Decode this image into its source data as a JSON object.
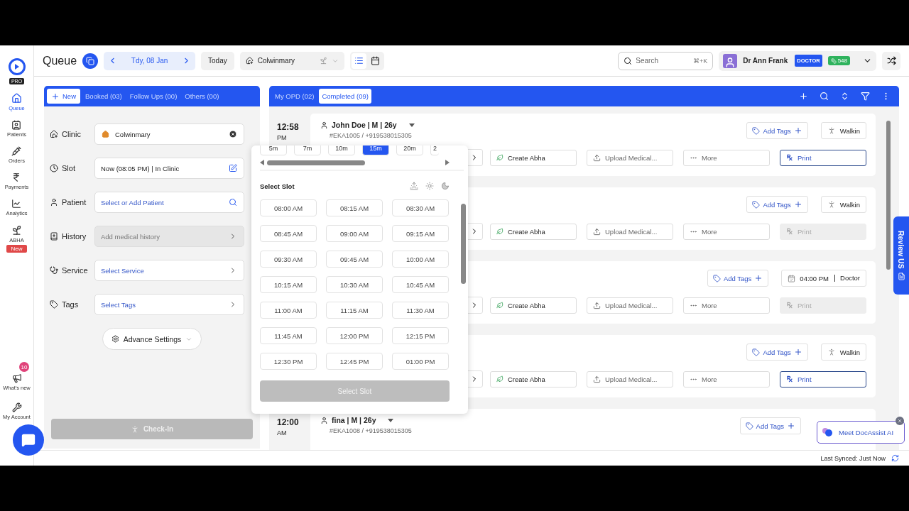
{
  "rail": {
    "plan": "PRO",
    "items": [
      {
        "label": "Queue",
        "kind": "queue",
        "selected": true
      },
      {
        "label": "Patients",
        "kind": "patients",
        "selected": false
      },
      {
        "label": "Orders",
        "kind": "orders",
        "selected": false
      },
      {
        "label": "Payments",
        "kind": "payments",
        "selected": false
      },
      {
        "label": "Analytics",
        "kind": "analytics",
        "selected": false
      },
      {
        "label": "ABHA",
        "kind": "abha",
        "selected": false,
        "badge": "New"
      }
    ],
    "bottom_items": [
      {
        "label": "What's new",
        "kind": "news",
        "badge": "10"
      },
      {
        "label": "My Account",
        "kind": "account"
      }
    ]
  },
  "header": {
    "title": "Queue",
    "date": "Tdy, 08 Jan",
    "today": "Today",
    "clinic": "Colwinmary",
    "views": [
      {
        "kind": "list",
        "selected": true
      },
      {
        "kind": "calendar",
        "selected": false
      }
    ],
    "search": {
      "placeholder": "Search",
      "shortcut": "⌘+K"
    },
    "user": {
      "name": "Dr Ann Frank",
      "role": "DOCTOR",
      "points": "548"
    }
  },
  "booking": {
    "tabs": [
      {
        "label": "New",
        "kind": "add",
        "selected": true
      },
      {
        "label": "Booked (03)",
        "kind": "tab",
        "selected": false
      },
      {
        "label": "Follow Ups (00)",
        "kind": "tab",
        "selected": false
      },
      {
        "label": "Others (00)",
        "kind": "tab",
        "selected": false
      }
    ],
    "fields": [
      {
        "label": "Clinic",
        "kind": "clinic",
        "value": "Colwinmary"
      },
      {
        "label": "Slot",
        "kind": "slot",
        "value": "Now (08:05 PM) | In Clinic"
      },
      {
        "label": "Patient",
        "kind": "patient",
        "placeholder": "Select or Add Patient"
      },
      {
        "label": "History",
        "kind": "history",
        "placeholder": "Add medical history",
        "disabled": true
      },
      {
        "label": "Service",
        "kind": "service",
        "placeholder": "Select Service"
      },
      {
        "label": "Tags",
        "kind": "tags",
        "placeholder": "Select Tags"
      }
    ],
    "advance_settings": "Advance Settings",
    "check_in": {
      "label": "Check-In",
      "disabled": true
    }
  },
  "slot_picker": {
    "durations": [
      {
        "label": "5m",
        "selected": false
      },
      {
        "label": "7m",
        "selected": false
      },
      {
        "label": "10m",
        "selected": false
      },
      {
        "label": "15m",
        "selected": true
      },
      {
        "label": "20m",
        "selected": false
      },
      {
        "label": "2",
        "selected": false
      }
    ],
    "title": "Select Slot",
    "slots": [
      "08:00 AM",
      "08:15 AM",
      "08:30 AM",
      "08:45 AM",
      "09:00 AM",
      "09:15 AM",
      "09:30 AM",
      "09:45 AM",
      "10:00 AM",
      "10:15 AM",
      "10:30 AM",
      "10:45 AM",
      "11:00 AM",
      "11:15 AM",
      "11:30 AM",
      "11:45 AM",
      "12:00 PM",
      "12:15 PM",
      "12:30 PM",
      "12:45 PM",
      "01:00 PM"
    ],
    "submit": {
      "label": "Select Slot",
      "disabled": true
    }
  },
  "opd": {
    "tabs": [
      {
        "label": "My OPD (02)",
        "selected": false
      },
      {
        "label": "Completed (09)",
        "selected": true
      }
    ],
    "cards": [
      {
        "time": "12:58",
        "meridiem": "PM",
        "patient": "John Doe | M | 26y",
        "id": "#EKA1005 / +919538015305",
        "tags": "Add Tags",
        "visit": {
          "kind": "walkin",
          "label": "Walkin"
        },
        "actions": [
          "Create Abha",
          "Upload Medical...",
          "More"
        ],
        "print": {
          "label": "Print",
          "disabled": false
        }
      },
      {
        "tags": "Add Tags",
        "visit": {
          "kind": "walkin",
          "label": "Walkin"
        },
        "actions": [
          "Create Abha",
          "Upload Medical...",
          "More"
        ],
        "print": {
          "label": "Print",
          "disabled": true
        }
      },
      {
        "tags": "Add Tags",
        "visit": {
          "kind": "appointment",
          "time": "04:00 PM",
          "label": "Doctor"
        },
        "actions": [
          "Create Abha",
          "Upload Medical...",
          "More"
        ],
        "print": {
          "label": "Print",
          "disabled": true
        }
      },
      {
        "tags": "Add Tags",
        "visit": {
          "kind": "walkin",
          "label": "Walkin"
        },
        "actions": [
          "Create Abha",
          "Upload Medical...",
          "More"
        ],
        "print": {
          "label": "Print",
          "disabled": false
        }
      },
      {
        "time": "12:00",
        "meridiem": "AM",
        "patient": "fina | M | 26y",
        "id": "#EKA1008 / +919538015305",
        "tags": "Add Tags"
      }
    ]
  },
  "review_tab": "Review US",
  "assistant": "Meet DocAssist AI",
  "footer": {
    "sync": "Last Synced: Just Now"
  }
}
